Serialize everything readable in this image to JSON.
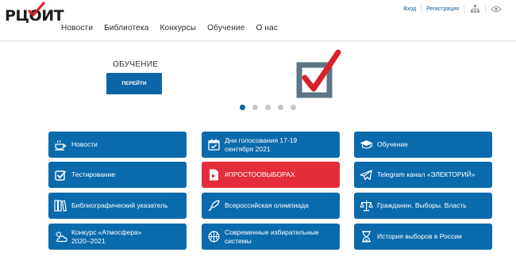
{
  "logo": {
    "text": "РЦОИТ"
  },
  "top_links": {
    "login": "Вход",
    "register": "Регистрация"
  },
  "nav": [
    "Новости",
    "Библиотека",
    "Конкурсы",
    "Обучение",
    "О нас"
  ],
  "slider": {
    "title": "ОБУЧЕНИЕ",
    "button": "ПЕРЕЙТИ",
    "dots_total": 5,
    "active_dot": 1
  },
  "tiles": [
    {
      "label": "Новости",
      "icon": "cup-icon"
    },
    {
      "label": "Дни голосования 17-19 сентября 2021",
      "icon": "calendar-check-icon"
    },
    {
      "label": "Обучение",
      "icon": "graduation-cap-icon"
    },
    {
      "label": "Тестирование",
      "icon": "checkbox-icon"
    },
    {
      "label": "#ПРОСТООВЫБОРАХ",
      "icon": "youtube-icon"
    },
    {
      "label": "Telegram канал «ЭЛЕКТОРИЙ»",
      "icon": "telegram-icon"
    },
    {
      "label": "Библиографический указатель",
      "icon": "books-icon"
    },
    {
      "label": "Всероссийская олимпиада",
      "icon": "feather-icon"
    },
    {
      "label": "Гражданин. Выборы. Власть",
      "icon": "scales-icon"
    },
    {
      "label": "Конкурс «Атмосфера» 2020–2021",
      "icon": "weather-icon"
    },
    {
      "label": "Современные избирательные системы",
      "icon": "basketball-icon"
    },
    {
      "label": "История выборов в России",
      "icon": "hourglass-icon"
    }
  ],
  "colors": {
    "primary": "#0a6aac",
    "accent": "#e42d3a",
    "check_red": "#d9202a",
    "box_gray": "#5d7483"
  }
}
